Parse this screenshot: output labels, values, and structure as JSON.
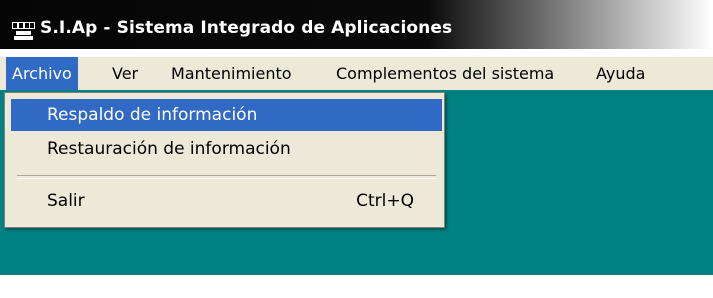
{
  "window": {
    "title": "S.I.Ap - Sistema Integrado de Aplicaciones",
    "icon": "app-logo-icon"
  },
  "menubar": {
    "items": [
      {
        "label": "Archivo",
        "active": true
      },
      {
        "label": "Ver"
      },
      {
        "label": "Mantenimiento"
      },
      {
        "label": "Complementos del sistema"
      },
      {
        "label": "Ayuda"
      }
    ]
  },
  "archivo_menu": {
    "items": [
      {
        "label": "Respaldo de información",
        "highlighted": true
      },
      {
        "label": "Restauración de información"
      },
      {
        "label": "Salir",
        "shortcut": "Ctrl+Q"
      }
    ]
  },
  "colors": {
    "workspace": "#008080",
    "highlight": "#316ac5",
    "menu_background": "#ece9d8"
  }
}
